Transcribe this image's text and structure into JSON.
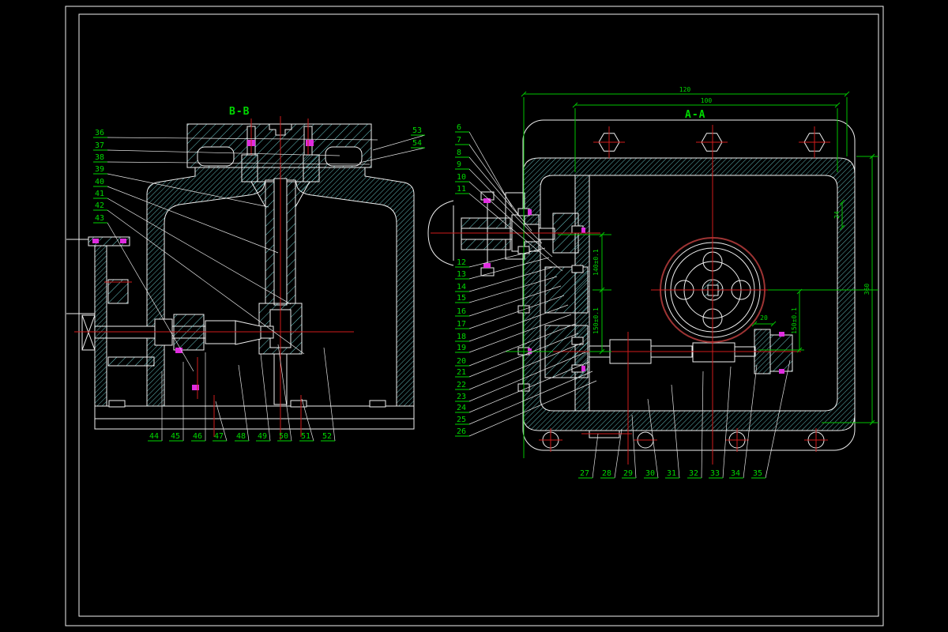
{
  "colors": {
    "background": "#000000",
    "line_white": "#f0f0f0",
    "hatch_cyan": "#7ae6e6",
    "label_green": "#00d900",
    "centerline_red": "#d01c1c",
    "pulley_ring_red": "#9e3434",
    "seal_magenta": "#e02ce0"
  },
  "views": {
    "bb": {
      "title": "B-B",
      "left_labels": [
        "36",
        "37",
        "38",
        "39",
        "40",
        "41",
        "42",
        "43"
      ],
      "bottom_labels": [
        "44",
        "45",
        "46",
        "47",
        "48",
        "49",
        "50",
        "51",
        "52"
      ],
      "top_right_labels": [
        "53",
        "54"
      ]
    },
    "aa": {
      "title": "A-A",
      "upper_left_labels": [
        "6",
        "7",
        "8",
        "9",
        "10",
        "11"
      ],
      "left_labels": [
        "12",
        "13",
        "14",
        "15",
        "16",
        "17",
        "18",
        "19",
        "20",
        "21",
        "22",
        "23",
        "24",
        "25",
        "26"
      ],
      "bottom_labels": [
        "27",
        "28",
        "29",
        "30",
        "31",
        "32",
        "33",
        "34",
        "35"
      ],
      "dimensions": {
        "overall_width": "120",
        "inner_width": "100",
        "overall_height": "360",
        "flange_offset": "24",
        "center_distance_upper": "140±0.1",
        "center_distance_lower": "150±0.1",
        "center_distance_right": "150±0.1",
        "bearing_width": "20"
      }
    }
  }
}
